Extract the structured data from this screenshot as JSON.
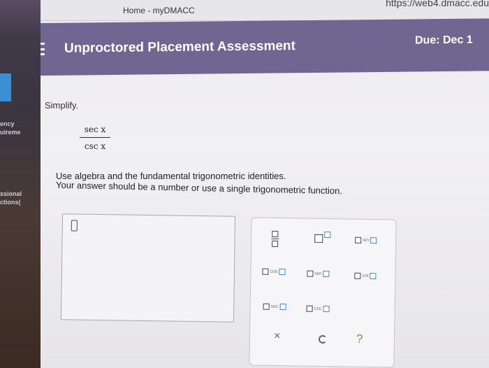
{
  "browser": {
    "tab_title": "Home - myDMACC",
    "url": "https://web4.dmacc.edu"
  },
  "left_edge": {
    "texts": [
      "ency",
      "uireme",
      "ssional",
      "ctions("
    ]
  },
  "header": {
    "title": "Unproctored Placement Assessment",
    "due": "Due: Dec 1"
  },
  "question": {
    "instruction": "Simplify.",
    "numerator": "sec x",
    "denominator": "csc x",
    "hint_line1": "Use algebra and the fundamental trigonometric identities.",
    "hint_line2": "Your answer should be a number or use a single trigonometric function."
  },
  "palette": {
    "row1": [
      "fraction",
      "exponent",
      "sin"
    ],
    "row2": [
      "cos",
      "tan",
      "cot"
    ],
    "row3": [
      "sec",
      "csc"
    ],
    "bottom": {
      "clear": "×",
      "help": "?"
    }
  },
  "colors": {
    "header_bg": "#6f6691",
    "input_square": "#3a88d0"
  }
}
